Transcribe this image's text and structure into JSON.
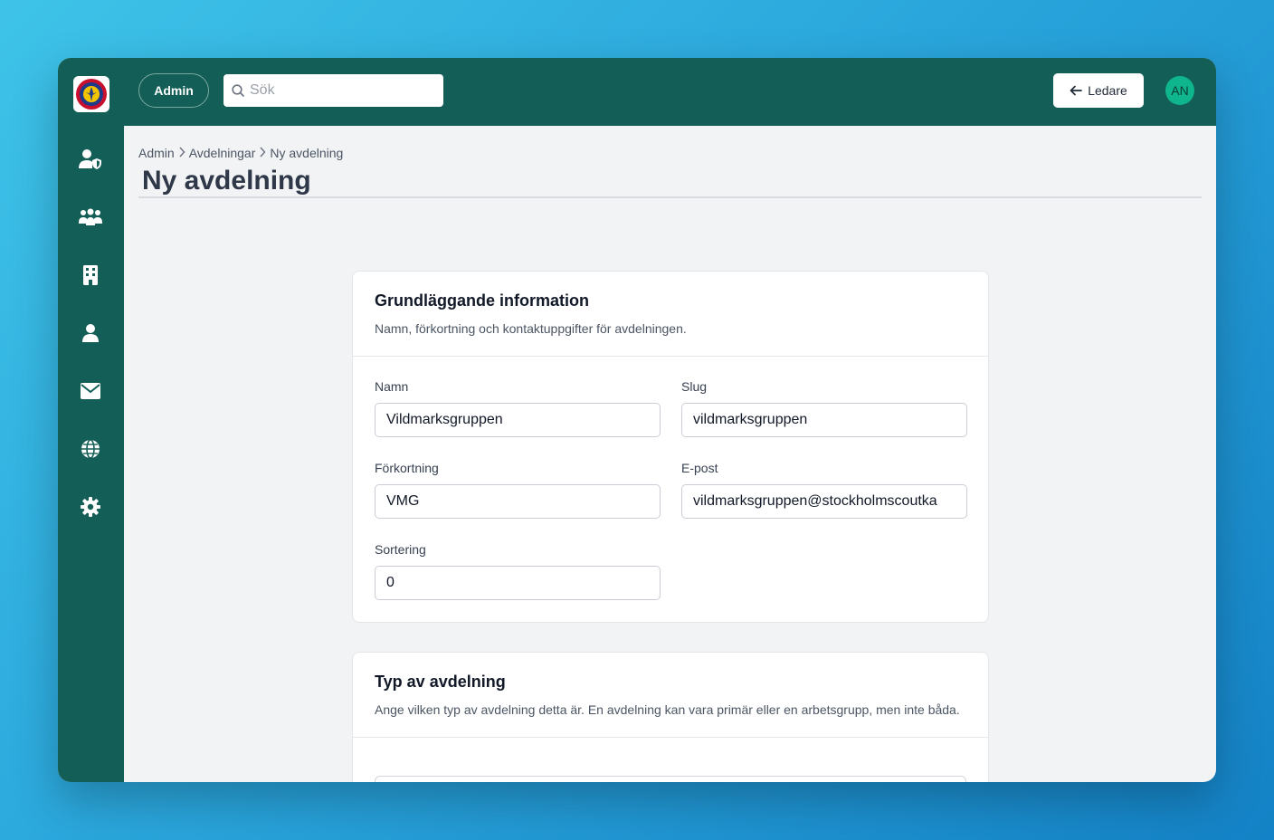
{
  "topbar": {
    "admin_label": "Admin",
    "search_placeholder": "Sök",
    "back_label": "Ledare",
    "avatar_initials": "AN"
  },
  "sidebar": {
    "items": [
      {
        "icon": "user-shield-icon"
      },
      {
        "icon": "users-icon"
      },
      {
        "icon": "building-icon"
      },
      {
        "icon": "user-icon"
      },
      {
        "icon": "envelope-icon"
      },
      {
        "icon": "globe-icon"
      },
      {
        "icon": "gear-icon"
      }
    ]
  },
  "breadcrumb": [
    "Admin",
    "Avdelningar",
    "Ny avdelning"
  ],
  "page_title": "Ny avdelning",
  "card1": {
    "title": "Grundläggande information",
    "description": "Namn, förkortning och kontaktuppgifter för avdelningen.",
    "fields": {
      "name": {
        "label": "Namn",
        "value": "Vildmarksgruppen"
      },
      "slug": {
        "label": "Slug",
        "value": "vildmarksgruppen"
      },
      "abbr": {
        "label": "Förkortning",
        "value": "VMG"
      },
      "email": {
        "label": "E-post",
        "value": "vildmarksgruppen@stockholmscoutka"
      },
      "sort": {
        "label": "Sortering",
        "value": "0"
      }
    }
  },
  "card2": {
    "title": "Typ av avdelning",
    "description": "Ange vilken typ av avdelning detta är. En avdelning kan vara primär eller en arbetsgrupp, men inte båda."
  },
  "colors": {
    "brand": "#135e56",
    "avatar": "#0fb58d"
  }
}
